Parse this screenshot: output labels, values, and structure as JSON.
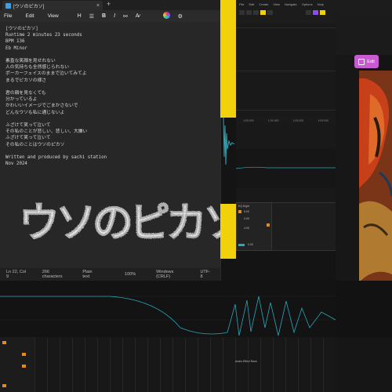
{
  "notepad": {
    "tab_title": "[ウソのピカソ]",
    "menu": {
      "file": "File",
      "edit": "Edit",
      "view": "View"
    },
    "toolbar": {
      "heading": "H",
      "bold": "B",
      "italic": "I"
    },
    "lines": [
      "[ウソのピカソ]",
      "Runtime 2 minutes 23 seconds",
      "BPM 136",
      "Eb Minor",
      "",
      "素直な笑顔を見せれない",
      "人の気持ちも全然感じられない",
      "ポーカーフェイスのままで泣いてみてよ",
      "まるでピカソの様さ",
      "",
      "君の顔を見なくても",
      "分かっているよ",
      "かわいいイメージでごまかさないで",
      "どんなウソも私に通じないよ",
      "",
      "ふざけて笑って泣いて",
      "その私のことが悲しい、悲しい、大嫌い",
      "ふざけて笑って泣いて",
      "その私のことはウソのピカソ",
      "",
      "Written and produced by sachi station",
      "Nov 2024"
    ],
    "logo_text": "ウソのピカソ",
    "status": {
      "position": "Ln 22, Col 9",
      "chars": "266 characters",
      "format": "Plain text",
      "zoom": "100%",
      "line_ending": "Windows (CRLF)",
      "encoding": "UTF-8"
    }
  },
  "daw": {
    "menu": [
      "File",
      "Edit",
      "Create",
      "View",
      "Navigate",
      "Options",
      "Help"
    ],
    "ruler": [
      "1:00:000",
      "1:01:000",
      "1:02:000",
      "1:03:000"
    ],
    "device": {
      "title": "EQ Eight",
      "value1": "5.00",
      "value2": "0.00",
      "value3": "4.00",
      "value4": "0.00"
    },
    "bottom_label": "Audio Effect Rack"
  },
  "editor": {
    "edit_label": "Edit"
  },
  "colors": {
    "yellow": "#f0d10a",
    "cyan": "#2aa7b8",
    "purple": "#c95bd2",
    "orange": "#e88a1a"
  }
}
